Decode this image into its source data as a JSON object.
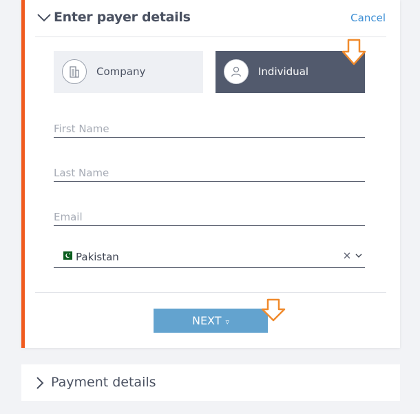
{
  "payer_section": {
    "title": "Enter payer details",
    "cancel_label": "Cancel",
    "accent_color": "#f05a1e",
    "payer_types": [
      {
        "label": "Company",
        "icon": "building-icon",
        "selected": false
      },
      {
        "label": "Individual",
        "icon": "person-icon",
        "selected": true
      }
    ],
    "fields": {
      "first_name_placeholder": "First Name",
      "last_name_placeholder": "Last Name",
      "email_placeholder": "Email"
    },
    "country": {
      "value": "Pakistan",
      "flag_icon": "pakistan-flag-icon"
    },
    "next_label": "NEXT",
    "next_caret": "▿",
    "next_color": "#63a3cf",
    "selected_tile_color": "#525a6d"
  },
  "payment_section": {
    "title": "Payment details"
  }
}
